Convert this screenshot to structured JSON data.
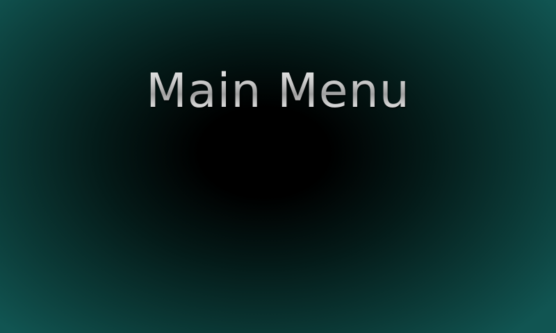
{
  "screen": {
    "title": "Main Menu"
  },
  "colors": {
    "background_center": "#000000",
    "background_edge": "#115552",
    "title_text": "#c8c8c8"
  }
}
